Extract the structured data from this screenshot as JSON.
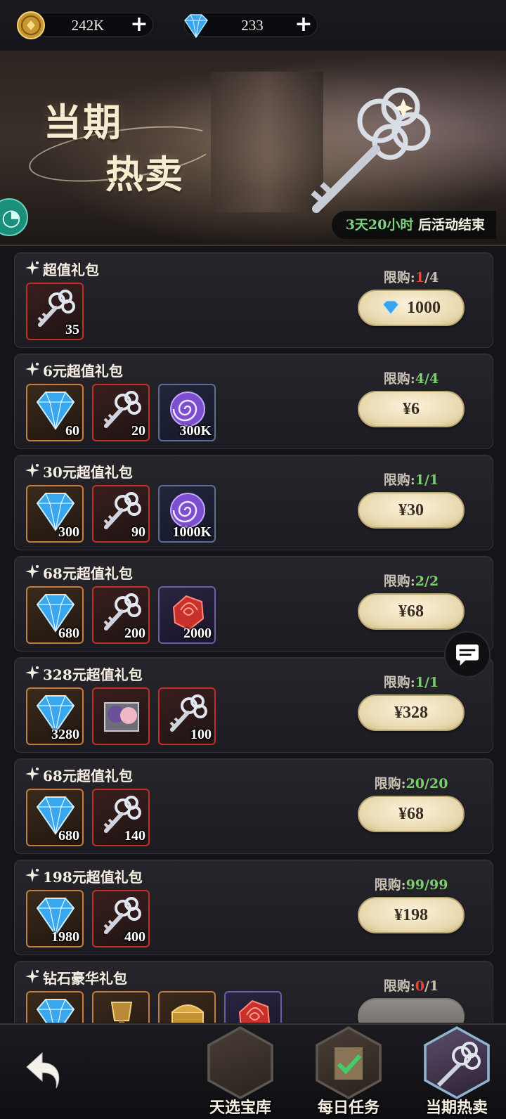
{
  "currencies": [
    {
      "icon": "gold-coin-icon",
      "value": "242K"
    },
    {
      "icon": "diamond-icon",
      "value": "233"
    }
  ],
  "banner": {
    "title_line1": "当期",
    "title_line2": "热卖",
    "countdown_highlight": "3天20小时",
    "countdown_rest": " 后活动结束"
  },
  "packs": [
    {
      "name": "超值礼包",
      "limit_label": "限购:",
      "limit_current": "1",
      "limit_total": "/4",
      "price": "1000",
      "price_type": "diamond",
      "items": [
        {
          "icon": "key-icon",
          "qty": "35",
          "frame": "red"
        }
      ]
    },
    {
      "name": "6元超值礼包",
      "limit_label": "限购:",
      "limit_current": "4",
      "limit_total": "/4",
      "price": "¥6",
      "items": [
        {
          "icon": "diamond-icon",
          "qty": "60",
          "frame": "orange"
        },
        {
          "icon": "key-icon",
          "qty": "20",
          "frame": "red"
        },
        {
          "icon": "swirl-orb-icon",
          "qty": "300K",
          "frame": "blue"
        }
      ]
    },
    {
      "name": "30元超值礼包",
      "limit_label": "限购:",
      "limit_current": "1",
      "limit_total": "/1",
      "price": "¥30",
      "items": [
        {
          "icon": "diamond-icon",
          "qty": "300",
          "frame": "orange"
        },
        {
          "icon": "key-icon",
          "qty": "90",
          "frame": "red"
        },
        {
          "icon": "swirl-orb-icon",
          "qty": "1000K",
          "frame": "blue"
        }
      ]
    },
    {
      "name": "68元超值礼包",
      "limit_label": "限购:",
      "limit_current": "2",
      "limit_total": "/2",
      "price": "¥68",
      "items": [
        {
          "icon": "diamond-icon",
          "qty": "680",
          "frame": "orange"
        },
        {
          "icon": "key-icon",
          "qty": "200",
          "frame": "red"
        },
        {
          "icon": "red-rose-icon",
          "qty": "2000",
          "frame": "purple"
        }
      ]
    },
    {
      "name": "328元超值礼包",
      "limit_label": "限购:",
      "limit_current": "1",
      "limit_total": "/1",
      "price": "¥328",
      "items": [
        {
          "icon": "diamond-icon",
          "qty": "3280",
          "frame": "orange"
        },
        {
          "icon": "character-box-icon",
          "qty": "",
          "frame": "red"
        },
        {
          "icon": "key-icon",
          "qty": "100",
          "frame": "red"
        }
      ]
    },
    {
      "name": "68元超值礼包",
      "limit_label": "限购:",
      "limit_current": "20",
      "limit_total": "/20",
      "price": "¥68",
      "items": [
        {
          "icon": "diamond-icon",
          "qty": "680",
          "frame": "orange"
        },
        {
          "icon": "key-icon",
          "qty": "140",
          "frame": "red"
        }
      ]
    },
    {
      "name": "198元超值礼包",
      "limit_label": "限购:",
      "limit_current": "99",
      "limit_total": "/99",
      "price": "¥198",
      "items": [
        {
          "icon": "diamond-icon",
          "qty": "1980",
          "frame": "orange"
        },
        {
          "icon": "key-icon",
          "qty": "400",
          "frame": "red"
        }
      ]
    },
    {
      "name": "钻石豪华礼包",
      "limit_label": "限购:",
      "limit_current": "0",
      "limit_total": "/1",
      "price": "",
      "items": [
        {
          "icon": "diamond-icon",
          "qty": "",
          "frame": "orange"
        },
        {
          "icon": "trophy-icon",
          "qty": "",
          "frame": "orange"
        },
        {
          "icon": "gold-chest-icon",
          "qty": "",
          "frame": "orange"
        },
        {
          "icon": "red-rose-icon",
          "qty": "",
          "frame": "purple"
        }
      ]
    }
  ],
  "nav": [
    {
      "label": "天选宝库",
      "icon": "treasure-vault-icon"
    },
    {
      "label": "每日任务",
      "icon": "daily-task-icon"
    },
    {
      "label": "当期热卖",
      "icon": "hot-sale-key-icon"
    }
  ]
}
